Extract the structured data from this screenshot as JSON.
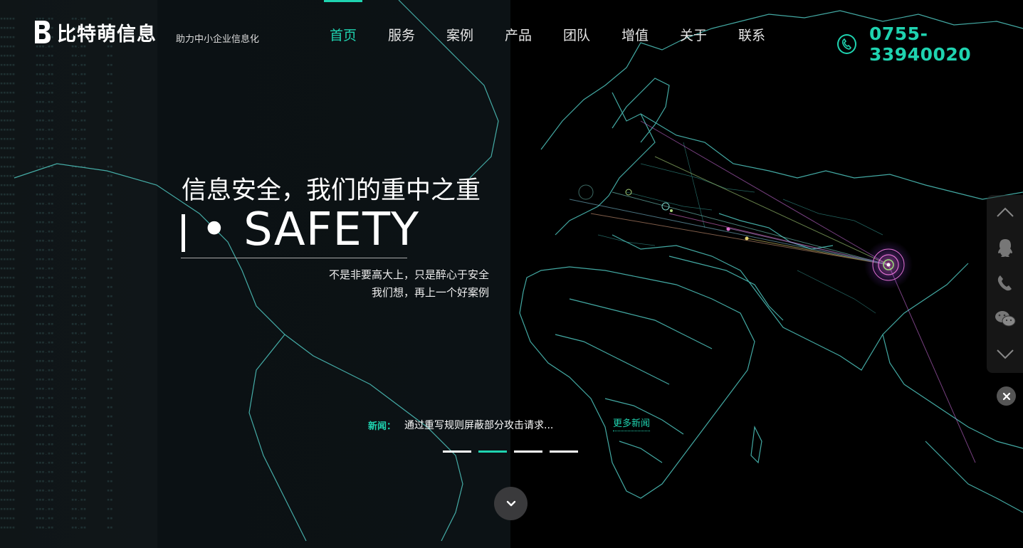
{
  "brand": {
    "logo_icon": "b-logo-icon",
    "name": "比特萌信息",
    "tagline": "助力中小企业信息化"
  },
  "nav": {
    "items": [
      {
        "label": "首页",
        "active": true
      },
      {
        "label": "服务",
        "active": false
      },
      {
        "label": "案例",
        "active": false
      },
      {
        "label": "产品",
        "active": false
      },
      {
        "label": "团队",
        "active": false
      },
      {
        "label": "增值",
        "active": false
      },
      {
        "label": "关于",
        "active": false
      },
      {
        "label": "联系",
        "active": false
      }
    ]
  },
  "contact": {
    "phone_icon": "phone-icon",
    "phone": "0755-33940020"
  },
  "hero": {
    "title": "信息安全，我们的重中之重",
    "subtitle": "• SAFETY",
    "line1": "不是非要高大上，只是醉心于安全",
    "line2": "我们想，再上一个好案例"
  },
  "news": {
    "label": "新闻：",
    "headline": "通过重写规则屏蔽部分攻击请求...",
    "more": "更多新闻"
  },
  "slider": {
    "count": 4,
    "active_index": 1
  },
  "side_toolbar": {
    "items": [
      "chevron-up-icon",
      "qq-icon",
      "phone-icon",
      "wechat-icon",
      "chevron-down-icon"
    ],
    "close_icon": "close-icon"
  },
  "colors": {
    "accent": "#1fd3b0",
    "background": "#000000",
    "panel": "#0b1114",
    "map_lines": "#4fc7c0"
  }
}
